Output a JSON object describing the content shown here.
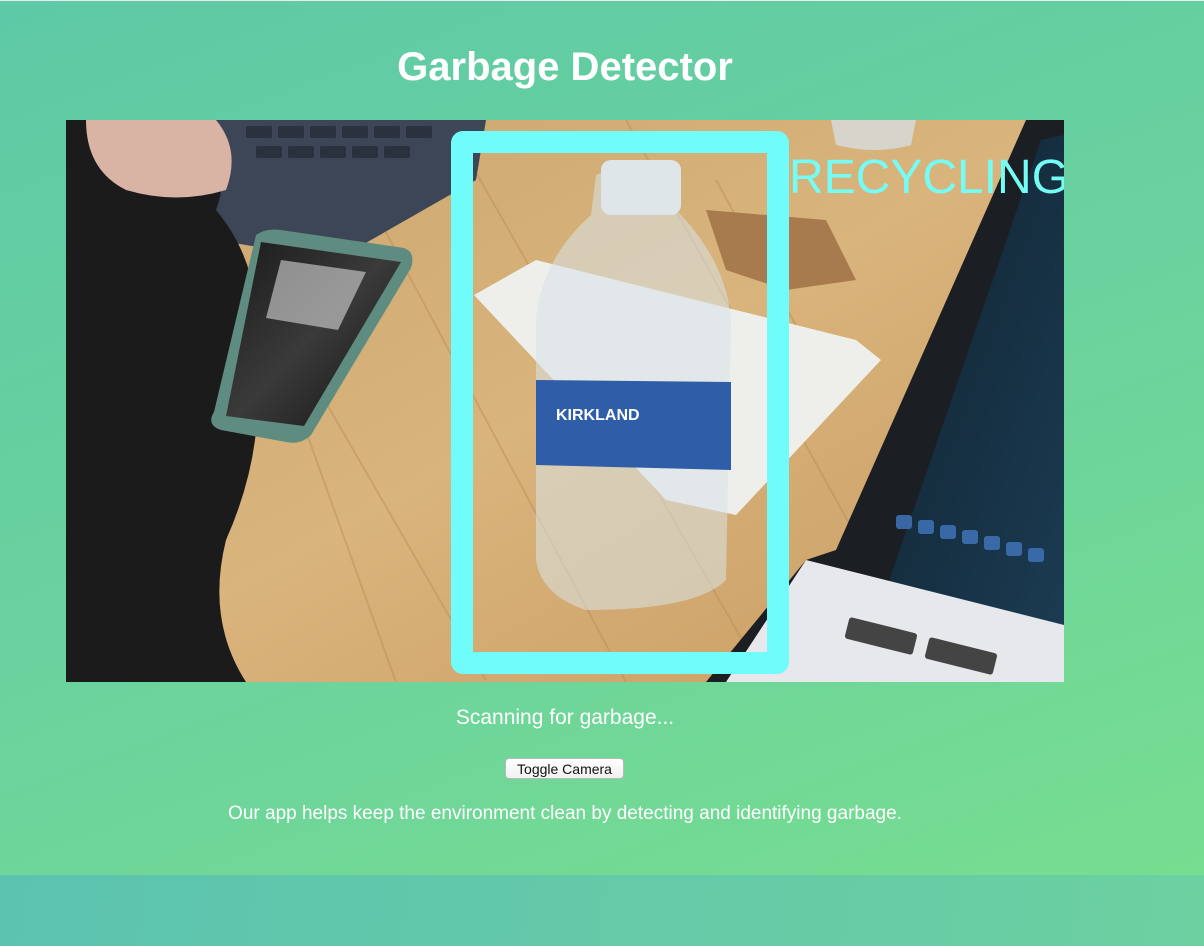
{
  "app": {
    "title": "Garbage Detector",
    "status_text": "Scanning for garbage...",
    "toggle_label": "Toggle Camera",
    "description": "Our app helps keep the environment clean by detecting and identifying garbage."
  },
  "detection": {
    "label": "RECYCLING",
    "box_color": "#6ffcfb"
  },
  "colors": {
    "gradient_start": "#5ec9a6",
    "gradient_end": "#77dd90",
    "text": "#ffffff"
  }
}
